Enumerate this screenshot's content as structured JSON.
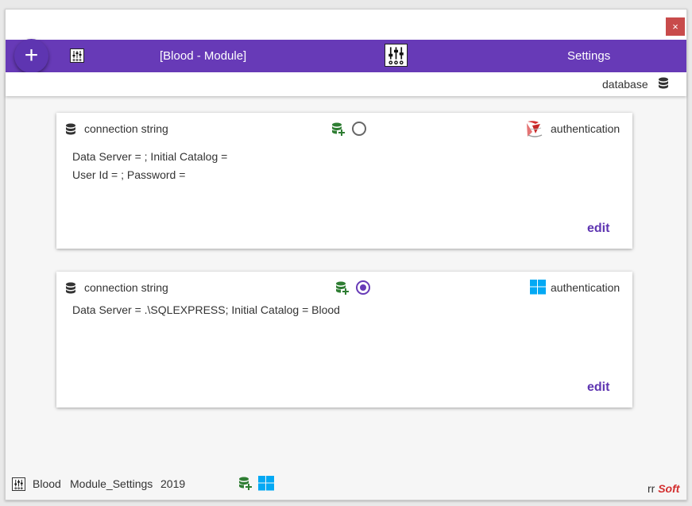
{
  "window": {
    "close_label": "×"
  },
  "navbar": {
    "add_label": "+",
    "title": "[Blood - Module]",
    "settings_label": "Settings"
  },
  "subbar": {
    "label": "database"
  },
  "cards": [
    {
      "header": "connection string",
      "auth_label": "authentication",
      "auth_icon": "sql-server-icon",
      "selected": false,
      "lines": [
        "Data Server = ;  Initial Catalog =",
        "User Id = ;  Password ="
      ],
      "edit_label": "edit"
    },
    {
      "header": "connection string",
      "auth_label": "authentication",
      "auth_icon": "windows-icon",
      "selected": true,
      "lines": [
        "Data Server = .\\SQLEXPRESS;  Initial Catalog = Blood"
      ],
      "edit_label": "edit"
    }
  ],
  "footer": {
    "module": "Blood",
    "settings": "Module_Settings",
    "year": "2019",
    "brand_prefix": "rr",
    "brand_name": "Soft"
  },
  "colors": {
    "primary": "#673ab7",
    "close": "#c84b4b",
    "db_green": "#2e7d32",
    "windows_blue": "#03a9f4",
    "brand_red": "#d32f2f"
  }
}
